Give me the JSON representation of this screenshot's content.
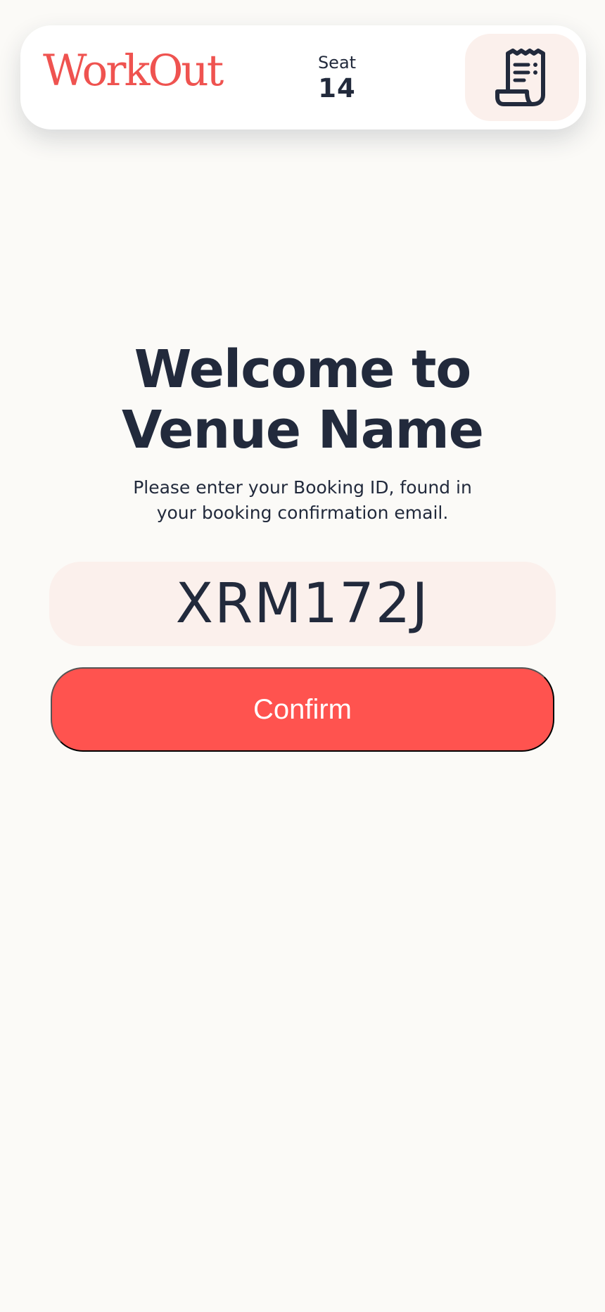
{
  "header": {
    "logo_text": "WorkOut",
    "seat_label": "Seat",
    "seat_number": "14",
    "receipt_button_icon": "receipt-icon"
  },
  "main": {
    "title_line_1": "Welcome to",
    "title_line_2": "Venue Name",
    "instructions_line_1": "Please enter your Booking ID, found in",
    "instructions_line_2": "your booking confirmation email.",
    "booking_id_value": "XRM172J",
    "confirm_label": "Confirm"
  },
  "colors": {
    "background": "#fbfaf7",
    "accent": "#ff534f",
    "logo": "#ef5350",
    "field_background": "#fbf0ec",
    "text": "#222a3c"
  }
}
